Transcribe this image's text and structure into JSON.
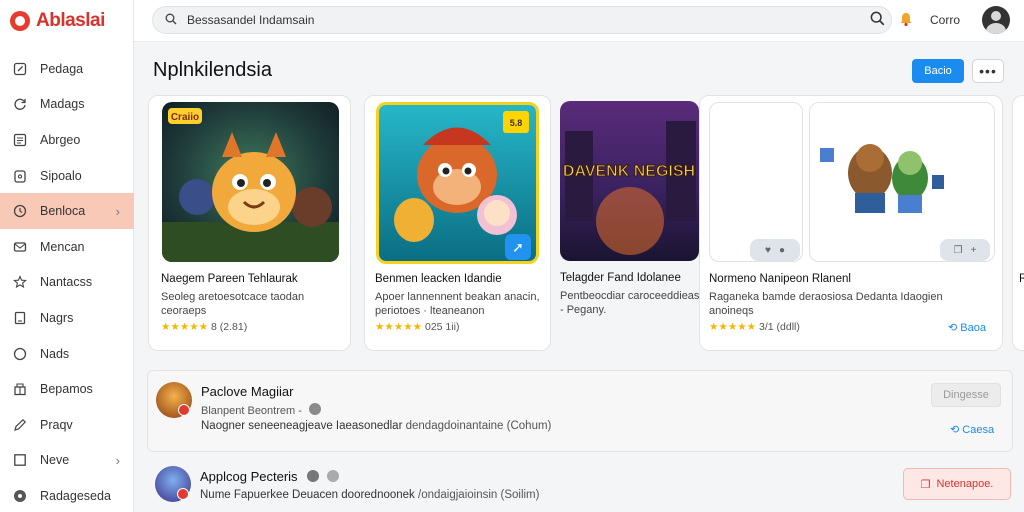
{
  "app": {
    "logo_text": "Ablaslai"
  },
  "topbar": {
    "search_value": "Bessasandel Indamsain",
    "user_name": "Corro"
  },
  "sidebar": {
    "items": [
      {
        "label": "Pedaga",
        "icon": "edit-icon"
      },
      {
        "label": "Madags",
        "icon": "refresh-icon"
      },
      {
        "label": "Abrgeo",
        "icon": "list-icon"
      },
      {
        "label": "Sipoalo",
        "icon": "clipboard-icon"
      },
      {
        "label": "Benloca",
        "icon": "clock-icon",
        "active": true
      },
      {
        "label": "Mencan",
        "icon": "mail-icon"
      },
      {
        "label": "Nantacss",
        "icon": "star-icon"
      },
      {
        "label": "Nagrs",
        "icon": "document-icon"
      },
      {
        "label": "Nads",
        "icon": "circle-icon"
      },
      {
        "label": "Bepamos",
        "icon": "box-icon"
      },
      {
        "label": "Praqv",
        "icon": "pen-icon"
      },
      {
        "label": "Neve",
        "icon": "square-icon"
      },
      {
        "label": "Radageseda",
        "icon": "disc-icon"
      }
    ]
  },
  "header": {
    "title": "Nplnkilendsia",
    "primary_button": "Bacio",
    "more_button": "•••"
  },
  "cards": [
    {
      "title": "Naegem Pareen Tehlaurak",
      "desc": "Seoleg aretoesotcace taodan ceoraeps",
      "stars": "★★★★★",
      "rating_text": "8 (2.81)",
      "art_label": "Craiio"
    },
    {
      "title": "Benmen leacken Idandie",
      "desc": "Apoer lannennent beakan anacin, periotoes · lteaneanon",
      "stars": "★★★★★",
      "rating_text": "025 1ii)",
      "action_icon": "arrow-icon",
      "badge_text": "5.8"
    },
    {
      "title": "Telagder Fand Idolanee",
      "desc": "Pentbeocdiar caroceeddieas - Pegany.",
      "art_text": "DAVENK NEGISH"
    },
    {
      "title": "Normeno Nanipeon Rlanenl",
      "desc": "Raganeka bamde deraosiosa Dedanta Idaogien anoineqs",
      "stars": "★★★★★",
      "rating_text": "3/1 (ddll)",
      "link_action": "Baoa"
    },
    {
      "title": "R"
    }
  ],
  "rows": [
    {
      "title": "Paclove Magiiar",
      "sub": "Blanpent Beontrem -",
      "text_prefix": "Naogner seneeneagjeave Iaeasonedlar ",
      "text_link": "dendagdoinantaine (Cohum)",
      "button": "Dingesse",
      "link_action": "Caesa"
    },
    {
      "title": "Applcog Pecteris",
      "text_prefix": "Nume  Fapuerkee Deuacen doorednoonek ",
      "text_link": "/ondaigjaioinsin (Soilim)",
      "button": "Netenapoe."
    }
  ],
  "colors": {
    "accent": "#1a8cf0",
    "brand": "#d9322a",
    "active_nav": "#f9c9b8",
    "star": "#f5b700"
  }
}
